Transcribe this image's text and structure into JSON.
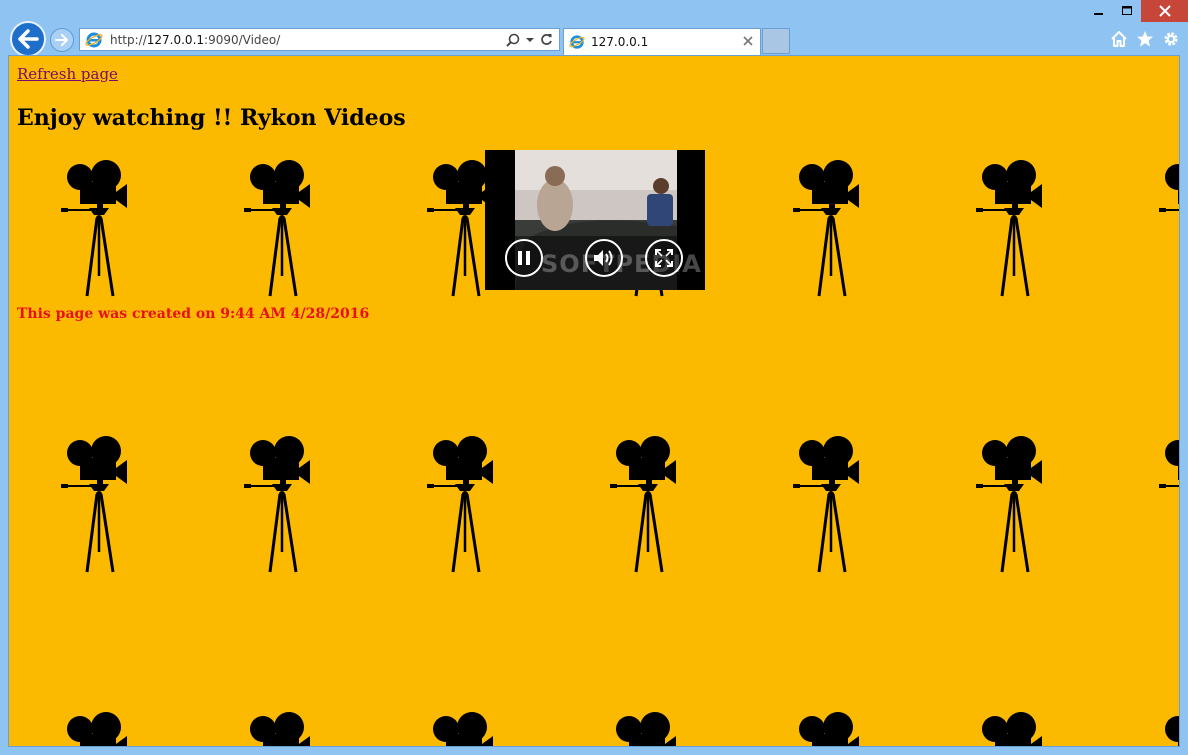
{
  "browser": {
    "address_url_prefix": "http://",
    "address_url_host": "127.0.0.1",
    "address_url_rest": ":9090/Video/",
    "tab_title": "127.0.0.1"
  },
  "page": {
    "refresh_link": "Refresh page",
    "heading": "Enjoy watching !! Rykon Videos",
    "created_text": "This page was created on 9:44 AM 4/28/2016"
  },
  "video": {
    "watermark": "SOFTPEDIA"
  },
  "icons": {
    "back": "back-arrow-icon",
    "forward": "forward-arrow-icon",
    "search": "search-icon",
    "refresh": "refresh-icon",
    "home": "home-icon",
    "favorites": "star-icon",
    "settings": "gear-icon",
    "pause": "pause-icon",
    "volume": "volume-icon",
    "fullscreen": "fullscreen-icon",
    "background": "movie-camera-icon"
  },
  "colors": {
    "page_background": "#fbb900",
    "created_text": "#e8101c",
    "link_visited": "#7a0a6e",
    "chrome": "#8ec3f2"
  }
}
